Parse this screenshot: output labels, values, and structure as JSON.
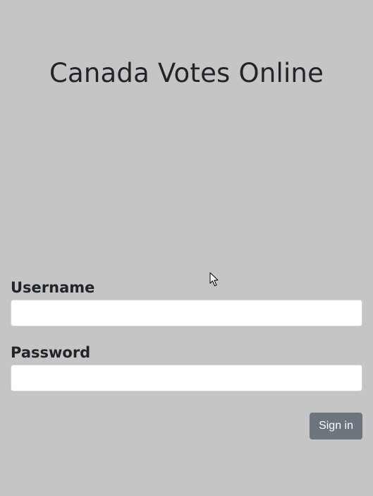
{
  "page": {
    "title": "Canada Votes Online",
    "background_color": "#c5c5c5"
  },
  "form": {
    "username": {
      "label": "Username",
      "value": "",
      "placeholder": ""
    },
    "password": {
      "label": "Password",
      "value": "",
      "placeholder": ""
    },
    "submit_label": "Sign in",
    "submit_color": "#6c757d"
  },
  "cursor": {
    "icon": "mouse-pointer-icon"
  }
}
